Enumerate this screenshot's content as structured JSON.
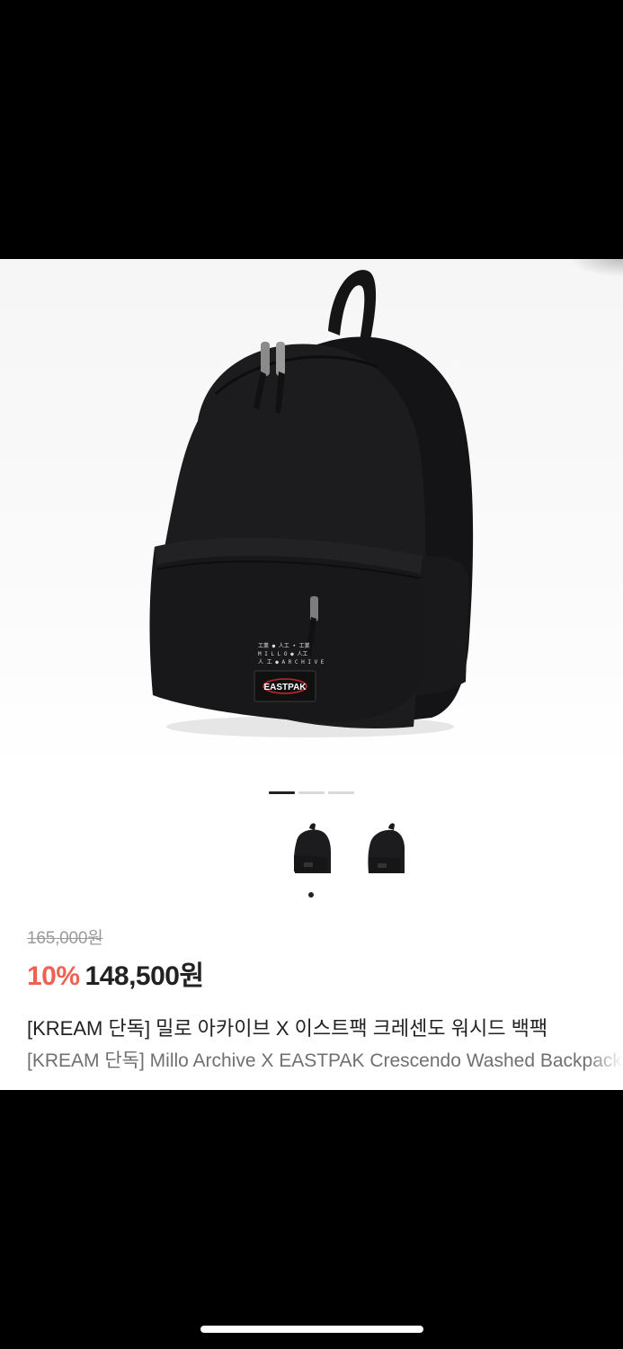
{
  "product": {
    "original_price": "165,000원",
    "discount": "10%",
    "price": "148,500원",
    "title_ko": "[KREAM 단독] 밀로 아카이브 X 이스트팩 크레센도 워시드 백팩",
    "title_en": "[KREAM 단독] Millo Archive X EASTPAK Crescendo Washed Backpack",
    "patch_brand": "EASTPAK"
  },
  "gallery": {
    "slide_count": 3,
    "active_slide": 1,
    "thumbnail_count": 2,
    "selected_thumbnail": 1
  },
  "colors": {
    "discount": "#ef6253",
    "bag": "#1c1c1e"
  }
}
